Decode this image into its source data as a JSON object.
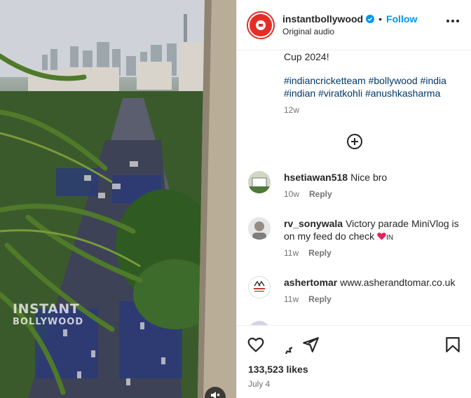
{
  "post": {
    "username": "instantbollywood",
    "follow_label": "Follow",
    "separator": "•",
    "audio": "Original audio",
    "caption_tail": "Cup 2024!",
    "hashtags": "#indiancricketteam #bollywood #india #indian #viratkohli #anushkasharma",
    "caption_time": "12w",
    "likes": "133,523 likes",
    "date": "July 4"
  },
  "media": {
    "watermark_line1": "INSTANT",
    "watermark_line2": "BOLLYWOOD"
  },
  "comments": [
    {
      "username": "hsetiawan518",
      "text": "Nice bro",
      "time": "10w",
      "reply": "Reply"
    },
    {
      "username": "rv_sonywala",
      "text": "Victory parade MiniVlog is on my feed do check",
      "suffix": "IN",
      "time": "11w",
      "reply": "Reply"
    },
    {
      "username": "ashertomar",
      "text": "www.asherandtomar.co.uk",
      "time": "11w",
      "reply": "Reply"
    }
  ],
  "icons": {
    "verified": "verified-badge-icon",
    "more": "more-options-icon",
    "load_more": "plus-circle-icon",
    "like": "heart-icon",
    "comment": "comment-icon",
    "share": "send-icon",
    "save": "bookmark-icon",
    "mute": "speaker-muted-icon"
  },
  "colors": {
    "follow": "#0095f6",
    "hashtag": "#00376b",
    "brand_red": "#e52d27",
    "verified": "#0095f6"
  }
}
